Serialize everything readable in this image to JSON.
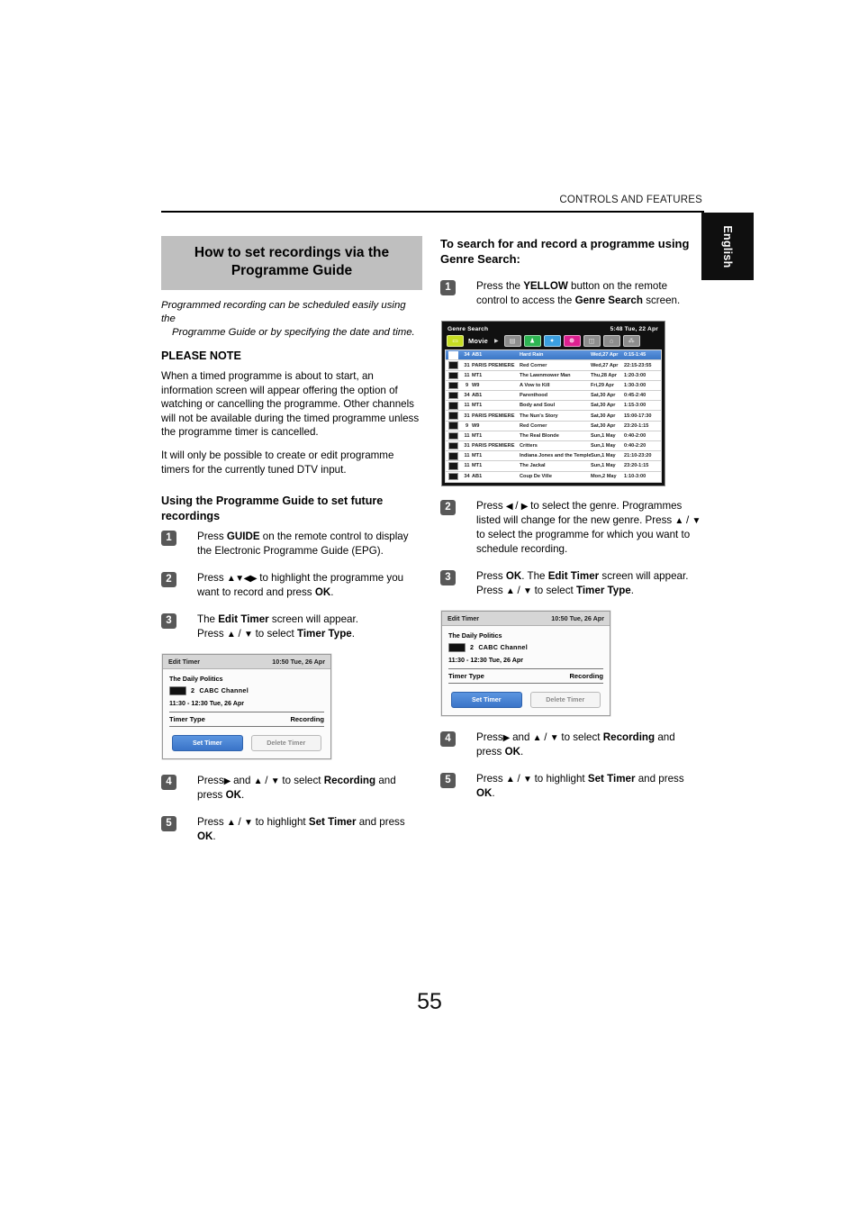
{
  "header": {
    "running_head": "CONTROLS AND FEATURES",
    "language_tab": "English"
  },
  "page_number": "55",
  "left_column": {
    "banner_title": "How to set recordings via the Programme Guide",
    "intro_line1": "Programmed recording can be scheduled easily using the",
    "intro_line2": "Programme Guide or by specifying the date and time.",
    "please_note_heading": "PLEASE NOTE",
    "note_paragraph_1": "When a timed programme is about to start, an information screen will appear offering the option of watching or cancelling the programme. Other channels will not be available during the timed programme unless the programme timer is cancelled.",
    "note_paragraph_2": "It will only be possible to create or edit programme timers for the currently tuned DTV input.",
    "subheading": "Using the Programme Guide to set future recordings",
    "steps": [
      {
        "num": "1",
        "html": "Press <b>GUIDE</b> on the remote control to display the Electronic Programme Guide (EPG)."
      },
      {
        "num": "2",
        "html": "Press <span class=\"arw\">▲▼◀▶</span> to highlight the programme you want to record and press <b>OK</b>."
      },
      {
        "num": "3",
        "html": "The <b>Edit Timer</b> screen will appear.<br>Press <span class=\"arw\">▲</span> / <span class=\"arw\">▼</span> to select <b>Timer Type</b>."
      },
      {
        "num": "4",
        "html": "Press<span class=\"arw\">▶</span> and <span class=\"arw\">▲</span> / <span class=\"arw\">▼</span> to select <b>Recording</b> and press <b>OK</b>."
      },
      {
        "num": "5",
        "html": "Press <span class=\"arw\">▲</span> / <span class=\"arw\">▼</span> to highlight <b>Set Timer</b> and press <b>OK</b>."
      }
    ]
  },
  "right_column": {
    "title": "To search for and record a programme using Genre Search:",
    "steps": [
      {
        "num": "1",
        "html": "Press the <b>YELLOW</b> button on the remote control to access the <b>Genre Search</b> screen."
      },
      {
        "num": "2",
        "html": "Press <span class=\"arw\">◀</span> / <span class=\"arw\">▶</span> to select the genre. Programmes listed will change for the new genre. Press <span class=\"arw\">▲</span> / <span class=\"arw\">▼</span> to select the programme for which you want to schedule recording."
      },
      {
        "num": "3",
        "html": "Press <b>OK</b>. The <b>Edit Timer</b> screen will appear.<br>Press <span class=\"arw\">▲</span> / <span class=\"arw\">▼</span> to select <b>Timer Type</b>."
      },
      {
        "num": "4",
        "html": "Press<span class=\"arw\">▶</span> and <span class=\"arw\">▲</span> / <span class=\"arw\">▼</span> to select <b>Recording</b> and press <b>OK</b>."
      },
      {
        "num": "5",
        "html": "Press <span class=\"arw\">▲</span> / <span class=\"arw\">▼</span> to highlight <b>Set Timer</b> and press <b>OK</b>."
      }
    ]
  },
  "edit_timer_screen": {
    "title": "Edit Timer",
    "clock": "10:50 Tue, 26 Apr",
    "programme_name": "The Daily Politics",
    "channel_number": "2",
    "channel_name": "CABC  Channel",
    "time_range": "11:30 - 12:30 Tue, 26 Apr",
    "timer_type_label": "Timer Type",
    "timer_type_value": "Recording",
    "set_timer_button": "Set Timer",
    "delete_timer_button": "Delete Timer"
  },
  "genre_search_screen": {
    "title": "Genre Search",
    "clock": "5:48 Tue, 22 Apr",
    "selected_genre": "Movie",
    "genre_tabs": [
      {
        "name": "movie-icon",
        "glyph": "▭",
        "color": "#c6dd22"
      },
      {
        "name": "news-icon",
        "glyph": "▤",
        "color": "#8d8d8d"
      },
      {
        "name": "show-icon",
        "glyph": "♟",
        "color": "#2eb553"
      },
      {
        "name": "sports-icon",
        "glyph": "✦",
        "color": "#3b9fe0"
      },
      {
        "name": "children-icon",
        "glyph": "❁",
        "color": "#dd2090"
      },
      {
        "name": "music-icon",
        "glyph": "◫",
        "color": "#8d8d8d"
      },
      {
        "name": "arts-icon",
        "glyph": "⌂",
        "color": "#8d8d8d"
      },
      {
        "name": "social-icon",
        "glyph": "⁂",
        "color": "#8d8d8d"
      }
    ],
    "columns": [
      "channel-icon",
      "number",
      "channel",
      "programme",
      "date",
      "time"
    ],
    "rows": [
      {
        "num": "34",
        "chan": "AB1",
        "title": "Hard Rain",
        "date": "Wed,27 Apr",
        "time": "0:15-1:45",
        "selected": true
      },
      {
        "num": "31",
        "chan": "PARIS PREMIERE",
        "title": "Red Corner",
        "date": "Wed,27 Apr",
        "time": "22:15-23:55",
        "selected": false
      },
      {
        "num": "11",
        "chan": "MT1",
        "title": "The Lawnmower Man",
        "date": "Thu,28 Apr",
        "time": "1:20-3:00",
        "selected": false
      },
      {
        "num": "9",
        "chan": "W9",
        "title": "A Vow to Kill",
        "date": "Fri,29 Apr",
        "time": "1:30-3:00",
        "selected": false
      },
      {
        "num": "34",
        "chan": "AB1",
        "title": "Parenthood",
        "date": "Sat,30 Apr",
        "time": "0:45-2:40",
        "selected": false
      },
      {
        "num": "11",
        "chan": "MT1",
        "title": "Body and Soul",
        "date": "Sat,30 Apr",
        "time": "1:15-3:00",
        "selected": false
      },
      {
        "num": "31",
        "chan": "PARIS PREMIERE",
        "title": "The Nun's Story",
        "date": "Sat,30 Apr",
        "time": "15:00-17:30",
        "selected": false
      },
      {
        "num": "9",
        "chan": "W9",
        "title": "Red Corner",
        "date": "Sat,30 Apr",
        "time": "23:20-1:15",
        "selected": false
      },
      {
        "num": "11",
        "chan": "MT1",
        "title": "The Real Blonde",
        "date": "Sun,1 May",
        "time": "0:40-2:00",
        "selected": false
      },
      {
        "num": "31",
        "chan": "PARIS PREMIERE",
        "title": "Critters",
        "date": "Sun,1 May",
        "time": "0:40-2:20",
        "selected": false
      },
      {
        "num": "11",
        "chan": "MT1",
        "title": "Indiana Jones and the Temple of Doom",
        "date": "Sun,1 May",
        "time": "21:10-23:20",
        "selected": false
      },
      {
        "num": "11",
        "chan": "MT1",
        "title": "The Jackal",
        "date": "Sun,1 May",
        "time": "23:20-1:15",
        "selected": false
      },
      {
        "num": "34",
        "chan": "AB1",
        "title": "Coup De Ville",
        "date": "Mon,2 May",
        "time": "1:10-3:00",
        "selected": false
      }
    ]
  }
}
